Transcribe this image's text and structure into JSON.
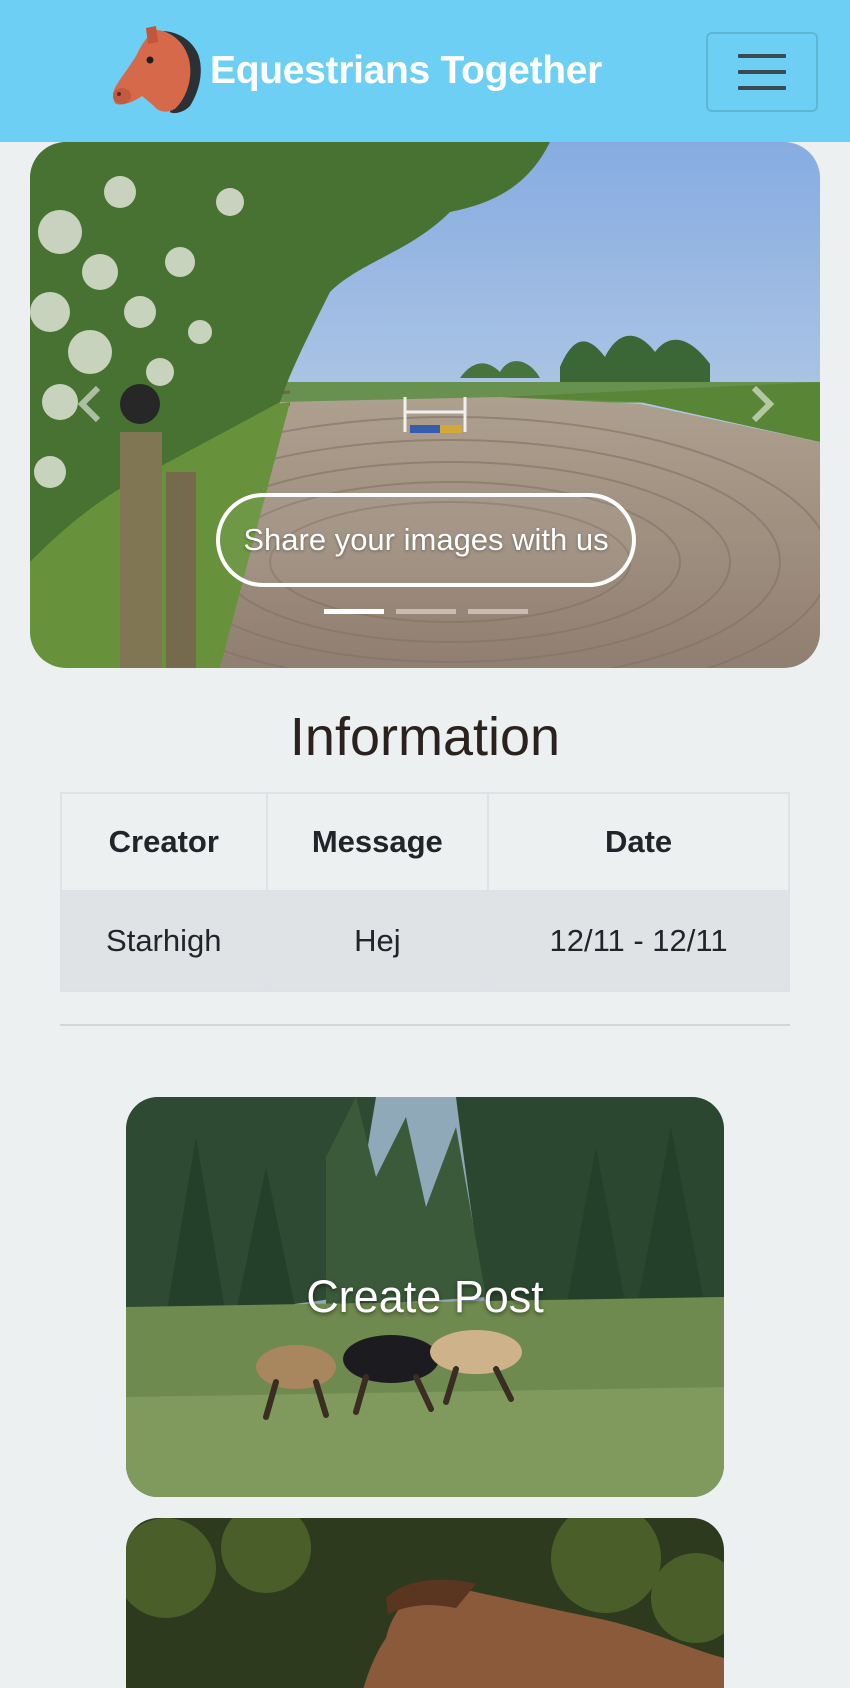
{
  "navbar": {
    "brand": "Equestrians Together",
    "logo_icon": "horse-head-icon",
    "toggler_icon": "hamburger-icon",
    "background_color": "#6dcff3"
  },
  "carousel": {
    "caption": "Share your images with us",
    "slide_count": 3,
    "active_slide": 1,
    "prev_icon": "chevron-left-icon",
    "next_icon": "chevron-right-icon"
  },
  "information": {
    "title": "Information",
    "columns": [
      "Creator",
      "Message",
      "Date"
    ],
    "rows": [
      [
        "Starhigh",
        "Hej",
        "12/11 - 12/11"
      ]
    ]
  },
  "cards": [
    {
      "label": "Create Post"
    },
    {
      "label": ""
    }
  ]
}
